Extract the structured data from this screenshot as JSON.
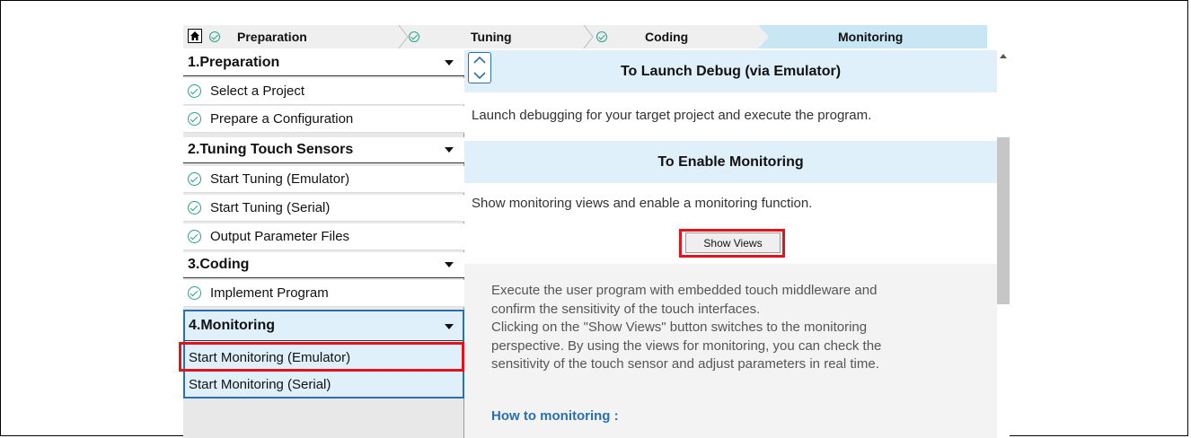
{
  "breadcrumb": {
    "home_icon": "home-icon",
    "steps": [
      {
        "label": "Preparation",
        "done": true
      },
      {
        "label": "Tuning",
        "done": true
      },
      {
        "label": "Coding",
        "done": true
      },
      {
        "label": "Monitoring",
        "done": false,
        "active": true
      }
    ]
  },
  "nav": {
    "sections": [
      {
        "title": "1.Preparation",
        "items": [
          "Select a Project",
          "Prepare a Configuration"
        ]
      },
      {
        "title": "2.Tuning Touch Sensors",
        "items": [
          "Start Tuning (Emulator)",
          "Start Tuning (Serial)",
          "Output Parameter Files"
        ]
      },
      {
        "title": "3.Coding",
        "items": [
          "Implement Program"
        ]
      },
      {
        "title": "4.Monitoring",
        "items": [
          "Start Monitoring (Emulator)",
          "Start Monitoring (Serial)"
        ]
      }
    ]
  },
  "content": {
    "launch_header": "To Launch Debug (via Emulator)",
    "launch_text": "Launch debugging for your target project and execute the program.",
    "enable_header": "To Enable Monitoring",
    "enable_text": "Show monitoring views and enable a monitoring function.",
    "show_views_button": "Show Views",
    "description_lines": [
      "Execute the user program with embedded touch middleware and",
      "confirm the sensitivity of the touch interfaces.",
      "Clicking on the \"Show Views\" button switches to the monitoring",
      "perspective. By using the views for monitoring, you can check the",
      "sensitivity of the touch sensor and adjust parameters in real time."
    ],
    "howto_label": "How to monitoring :"
  },
  "colors": {
    "accent_blue": "#2a6fb0",
    "highlight_red": "#e0141e",
    "check_green": "#26a387",
    "active_bg": "#c9e6f5",
    "header_bg": "#dff0fa"
  }
}
